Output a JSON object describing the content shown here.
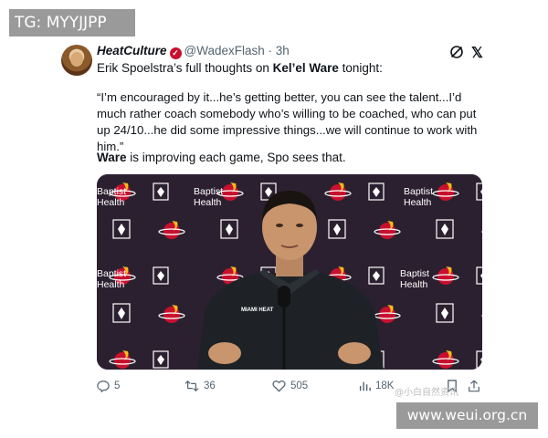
{
  "overlay": {
    "tg_label": "TG: MYYJJPP",
    "site_label": "www.weui.org.cn",
    "cn_watermark": "@小白自然资讯"
  },
  "tweet": {
    "display_name": "HeatCulture",
    "verified": true,
    "handle": "@WadexFlash",
    "separator": "·",
    "time": "3h",
    "intro_prefix": "Erik Spoelstra’s full thoughts on ",
    "intro_name": "Kel’el Ware",
    "intro_suffix": " tonight:",
    "quote": "“I’m encouraged by it...he’s getting better, you can see the talent...I’d much rather coach somebody who’s willing to be coached, who can put up 24/10...he did some impressive things...we will continue to work with him.”",
    "tagline_bold": "Ware",
    "tagline_rest": " is improving each game, Spo sees that.",
    "backdrop_text_line1": "Baptist",
    "backdrop_text_line2": "Health",
    "jersey_text": "MIAMI HEAT"
  },
  "actions": {
    "replies": "5",
    "reposts": "36",
    "likes": "505",
    "views": "18K"
  },
  "icons": {
    "grok": "grok-icon",
    "x": "x-logo-icon",
    "reply": "reply-icon",
    "repost": "repost-icon",
    "like": "heart-icon",
    "views": "views-icon",
    "bookmark": "bookmark-icon",
    "share": "share-icon"
  },
  "colors": {
    "heat_red": "#c8102e",
    "backdrop": "#2a1f2c",
    "muted": "#536471"
  }
}
